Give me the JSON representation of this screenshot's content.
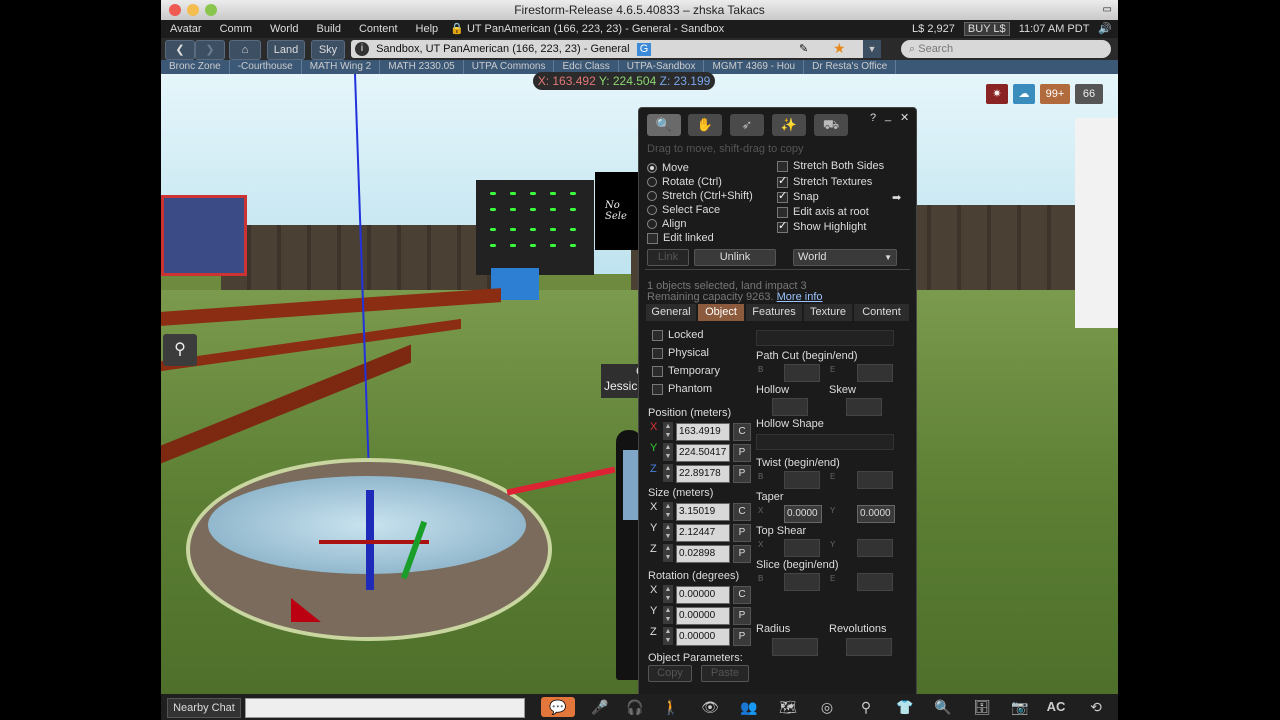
{
  "window": {
    "title": "Firestorm-Release 4.6.5.40833 – zhska Takacs"
  },
  "menu": {
    "items": [
      "Avatar",
      "Comm",
      "World",
      "Build",
      "Content",
      "Help"
    ],
    "region": "UT PanAmerican (166, 223, 23) - General - Sandbox",
    "balance": "L$ 2,927",
    "buy": "BUY L$",
    "time": "11:07 AM PDT"
  },
  "nav": {
    "land": "Land",
    "sky": "Sky",
    "location": "Sandbox, UT PanAmerican (166, 223, 23) - General",
    "maturity": "G",
    "search_placeholder": "Search"
  },
  "favorites": [
    "Bronc Zone",
    "-Courthouse",
    "MATH Wing 2",
    "MATH 2330.05",
    "UTPA Commons",
    "Edci Class",
    "UTPA-Sandbox",
    "MGMT 4369 - Hou",
    "Dr Resta's Office"
  ],
  "coords": {
    "x": "X: 163.492",
    "y": "Y: 224.504",
    "z": "Z: 23.199"
  },
  "hud": {
    "notifications": "99+",
    "count": "66"
  },
  "scene": {
    "sign_text": "No Sele",
    "name_tag": "Jessic",
    "name_tag2": "C"
  },
  "build": {
    "help": "?",
    "hint": "Drag to move, shift-drag to copy",
    "tools": {
      "move": "Move",
      "rotate": "Rotate (Ctrl)",
      "stretch": "Stretch (Ctrl+Shift)",
      "select_face": "Select Face",
      "align": "Align",
      "edit_linked": "Edit linked"
    },
    "options": {
      "stretch_both": "Stretch Both Sides",
      "stretch_textures": "Stretch Textures",
      "snap": "Snap",
      "edit_axis": "Edit axis at root",
      "show_highlight": "Show Highlight"
    },
    "link": "Link",
    "unlink": "Unlink",
    "ruler": "World",
    "selection_info": "1 objects selected, land impact 3",
    "remaining": "Remaining capacity 9263.",
    "more_info": "More info",
    "tabs": [
      "General",
      "Object",
      "Features",
      "Texture",
      "Content"
    ],
    "flags": {
      "locked": "Locked",
      "physical": "Physical",
      "temporary": "Temporary",
      "phantom": "Phantom"
    },
    "position_label": "Position (meters)",
    "position": {
      "x": "163.4919",
      "y": "224.50417",
      "z": "22.89178"
    },
    "size_label": "Size (meters)",
    "size": {
      "x": "3.15019",
      "y": "2.12447",
      "z": "0.02898"
    },
    "rotation_label": "Rotation (degrees)",
    "rotation": {
      "x": "0.00000",
      "y": "0.00000",
      "z": "0.00000"
    },
    "axis": {
      "x": "X",
      "y": "Y",
      "z": "Z"
    },
    "btn": {
      "c": "C",
      "p": "P"
    },
    "params_label": "Object Parameters:",
    "copy": "Copy",
    "paste": "Paste",
    "path_cut": "Path Cut (begin/end)",
    "hollow": "Hollow",
    "skew": "Skew",
    "hollow_shape": "Hollow Shape",
    "twist": "Twist (begin/end)",
    "taper": "Taper",
    "taper_x": "0.0000",
    "taper_y": "0.0000",
    "top_shear": "Top Shear",
    "slice": "Slice (begin/end)",
    "radius": "Radius",
    "revolutions": "Revolutions",
    "small": {
      "b": "B",
      "e": "E",
      "x": "X",
      "y": "Y"
    }
  },
  "bottom": {
    "nearby_chat": "Nearby Chat",
    "ac": "AC"
  }
}
